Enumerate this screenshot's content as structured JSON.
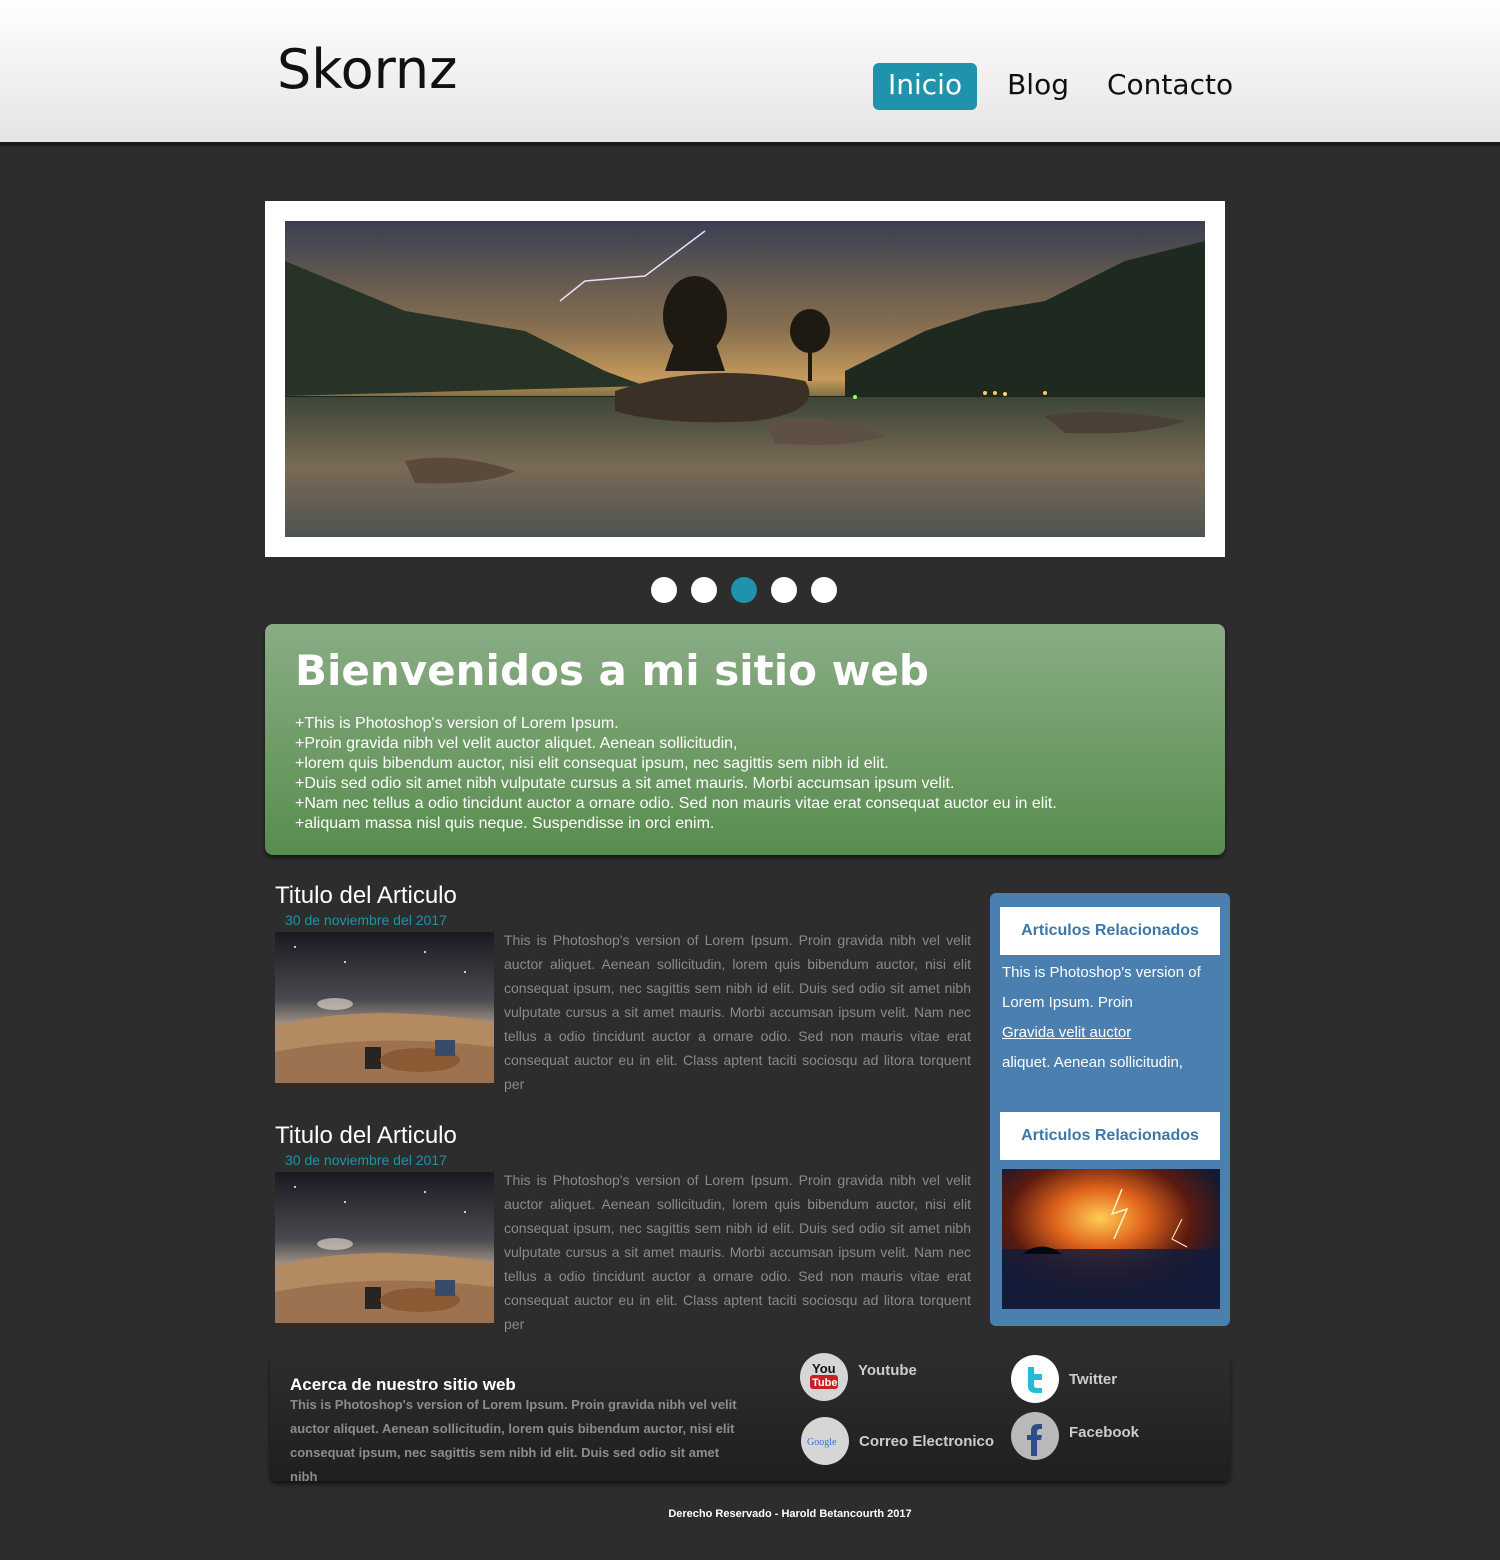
{
  "header": {
    "logo": "Skornz",
    "nav": [
      "Inicio",
      "Blog",
      "Contacto"
    ]
  },
  "slider": {
    "image": "landscape-lake-storm-image",
    "dots_count": 5,
    "active_dot": 3
  },
  "welcome": {
    "title": "Bienvenidos a mi sitio web",
    "lines": [
      "+This is Photoshop's version  of Lorem Ipsum.",
      "+Proin gravida nibh vel velit auctor aliquet. Aenean sollicitudin,",
      "+lorem quis bibendum auctor, nisi elit consequat ipsum, nec sagittis sem nibh id elit.",
      "+Duis sed odio sit amet nibh vulputate cursus a sit amet mauris. Morbi accumsan ipsum velit.",
      "+Nam nec tellus a odio tincidunt auctor a ornare odio. Sed non  mauris vitae erat consequat auctor eu in elit.",
      "+aliquam massa nisl quis neque. Suspendisse in orci enim."
    ]
  },
  "articles": [
    {
      "title": "Titulo del Articulo",
      "date": "30 de noviembre del 2017",
      "text": "This is Photoshop's version  of Lorem Ipsum. Proin gravida nibh vel velit auctor aliquet. Aenean sollicitudin, lorem quis bibendum auctor, nisi elit consequat ipsum, nec sagittis sem nibh id elit. Duis sed odio sit amet nibh vulputate cursus a sit amet mauris. Morbi accumsan ipsum velit. Nam nec tellus a odio tincidunt auctor a ornare odio. Sed non  mauris vitae erat consequat auctor eu in elit. Class aptent taciti sociosqu ad litora torquent per"
    },
    {
      "title": "Titulo del Articulo",
      "date": "30 de noviembre del 2017",
      "text": "This is Photoshop's version  of Lorem Ipsum. Proin gravida nibh vel velit auctor aliquet. Aenean sollicitudin, lorem quis bibendum auctor, nisi elit consequat ipsum, nec sagittis sem nibh id elit. Duis sed odio sit amet nibh vulputate cursus a sit amet mauris. Morbi accumsan ipsum velit. Nam nec tellus a odio tincidunt auctor a ornare odio. Sed non  mauris vitae erat consequat auctor eu in elit. Class aptent taciti sociosqu ad litora torquent per"
    }
  ],
  "sidebar": {
    "title1": "Articulos Relacionados",
    "text_before": "This is Photoshop's version of Lorem Ipsum. Proin",
    "link": "Gravida  velit auctor",
    "text_after": "aliquet. Aenean sollicitudin,",
    "title2": "Articulos Relacionados"
  },
  "footer": {
    "about_title": "Acerca de nuestro sitio web",
    "about_text": "This is Photoshop's version  of Lorem Ipsum. Proin gravida nibh vel velit auctor aliquet. Aenean sollicitudin, lorem quis bibendum auctor, nisi elit consequat ipsum, nec sagittis sem nibh id elit. Duis sed odio sit amet nibh",
    "social": {
      "youtube": "Youtube",
      "twitter": "Twitter",
      "email": "Correo Electronico",
      "facebook": "Facebook",
      "youtube_icon_text_1": "You",
      "youtube_icon_text_2": "Tube",
      "google_icon_text": "Google"
    },
    "copyright": "Derecho Reservado - Harold Betancourth 2017"
  },
  "colors": {
    "accent": "#1e93ab",
    "sidebar": "#4a7fb0",
    "welcome_top": "#8aac85",
    "welcome_bottom": "#588d4e",
    "background": "#2d2d2d"
  }
}
